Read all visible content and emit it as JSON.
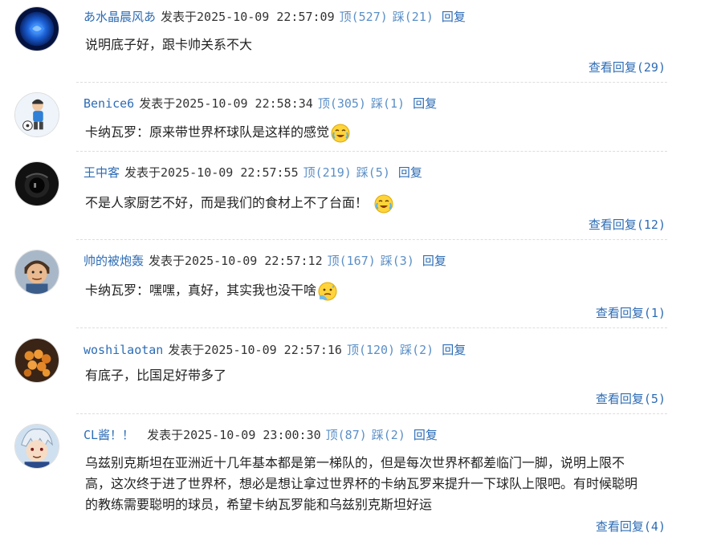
{
  "comments": [
    {
      "user": "あ水晶晨风あ",
      "posted": "发表于2025-10-09 22:57:09",
      "up": "顶(527)",
      "down": "踩(21)",
      "reply": "回复",
      "lines": [
        "说明底子好，跟卡帅关系不大"
      ],
      "view_replies": "查看回复(29)"
    },
    {
      "user": "Benice6",
      "posted": "发表于2025-10-09 22:58:34",
      "up": "顶(305)",
      "down": "踩(1)",
      "reply": "回复",
      "lines": [
        "卡纳瓦罗：原来带世界杯球队是这样的感觉"
      ],
      "emoji": "crying-laugh-emoji-icon"
    },
    {
      "user": "王中客",
      "posted": "发表于2025-10-09 22:57:55",
      "up": "顶(219)",
      "down": "踩(5)",
      "reply": "回复",
      "lines": [
        "不是人家厨艺不好，而是我们的食材上不了台面！"
      ],
      "emoji": "crying-laugh-emoji-icon",
      "view_replies": "查看回复(12)"
    },
    {
      "user": "帅的被炮轰",
      "posted": "发表于2025-10-09 22:57:12",
      "up": "顶(167)",
      "down": "踩(3)",
      "reply": "回复",
      "lines": [
        "卡纳瓦罗：嘿嘿，真好，其实我也没干啥"
      ],
      "emoji": "awkward-sweat-emoji-icon",
      "view_replies": "查看回复(1)"
    },
    {
      "user": "woshilaotan",
      "posted": "发表于2025-10-09 22:57:16",
      "up": "顶(120)",
      "down": "踩(2)",
      "reply": "回复",
      "lines": [
        "有底子，比国足好带多了"
      ],
      "view_replies": "查看回复(5)"
    },
    {
      "user": "CL酱！！",
      "posted": "发表于2025-10-09 23:00:30",
      "up": "顶(87)",
      "down": "踩(2)",
      "reply": "回复",
      "lines": [
        "乌兹别克斯坦在亚洲近十几年基本都是第一梯队的，但是每次世界杯都差临门一脚，说明上限不",
        "高，这次终于进了世界杯，想必是想让拿过世界杯的卡纳瓦罗来提升一下球队上限吧。有时候聪明",
        "的教练需要聪明的球员，希望卡纳瓦罗能和乌兹别克斯坦好运"
      ],
      "view_replies": "查看回复(4)"
    }
  ],
  "colors": {
    "username": "#2d6cb5",
    "vote": "#5b8fc7",
    "text": "#222222",
    "divider": "#dddddd"
  }
}
